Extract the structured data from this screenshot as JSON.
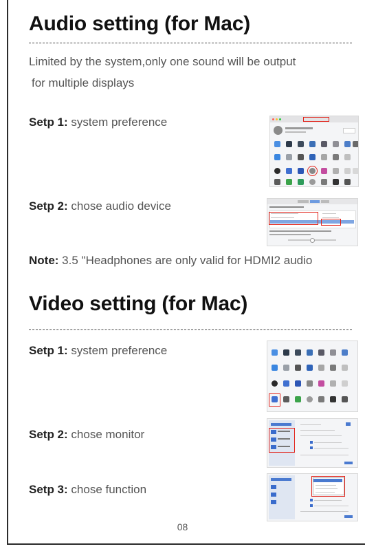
{
  "audio": {
    "title": "Audio setting (for Mac)",
    "intro_line1": "Limited by the system,only one sound will be output",
    "intro_line2": "for multiple displays",
    "step1_label": "Setp 1:",
    "step1_text": " system preference",
    "step2_label": "Setp 2:",
    "step2_text": " chose audio device",
    "note_label": "Note:",
    "note_text": " 3.5 \"Headphones are only valid for HDMI2 audio"
  },
  "video": {
    "title": "Video setting (for Mac)",
    "step1_label": "Setp 1:",
    "step1_text": " system preference",
    "step2_label": "Setp 2:",
    "step2_text": " chose monitor",
    "step3_label": "Setp 3:",
    "step3_text": " chose function"
  },
  "page_number": "08",
  "colors": {
    "highlight_red": "#e2231a",
    "heading": "#111111",
    "body_text": "#555555"
  }
}
